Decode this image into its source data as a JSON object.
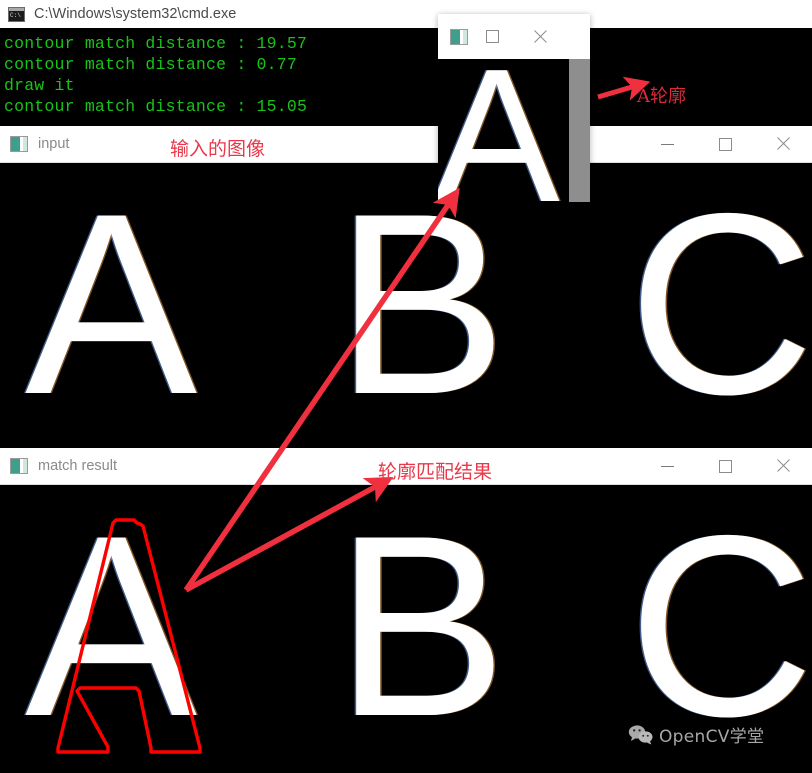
{
  "console": {
    "title": "C:\\Windows\\system32\\cmd.exe",
    "icon": "cmd-icon",
    "text_color": "#17c417",
    "background": "#000000",
    "lines": [
      "contour match distance : 19.57",
      "contour match distance : 0.77",
      "draw it",
      "contour match distance : 15.05"
    ]
  },
  "windows": {
    "input": {
      "title": "input",
      "icon": "opencv-window-icon",
      "controls": {
        "minimize": "minimize-button",
        "maximize": "maximize-button",
        "close": "close-button"
      },
      "letters": [
        "A",
        "B",
        "C"
      ]
    },
    "match_result": {
      "title": "match result",
      "icon": "opencv-window-icon",
      "controls": {
        "minimize": "minimize-button",
        "maximize": "maximize-button",
        "close": "close-button"
      },
      "letters": [
        "A",
        "B",
        "C"
      ],
      "contour_color": "#ff0000",
      "contour_on_letter": "A"
    },
    "contour_popup": {
      "title": "",
      "icon": "opencv-window-icon",
      "controls": {
        "maximize": "maximize-button",
        "close": "close-button"
      },
      "letter": "A",
      "scrollbar_color": "#8e8e8e"
    }
  },
  "annotations": [
    {
      "id": "input-image-label",
      "text": "输入的图像",
      "color": "#e8384a"
    },
    {
      "id": "a-contour-label",
      "text": "A轮廓",
      "color": "#d82b3c"
    },
    {
      "id": "match-result-label",
      "text": "轮廓匹配结果",
      "color": "#e8384a"
    }
  ],
  "watermark": {
    "text": "OpenCV学堂",
    "icon": "wechat-icon"
  },
  "colors": {
    "console_green": "#17c417",
    "annotation_red": "#e8384a",
    "contour_red": "#ff0000",
    "titlebar_white": "#ffffff",
    "canvas_black": "#000000"
  }
}
